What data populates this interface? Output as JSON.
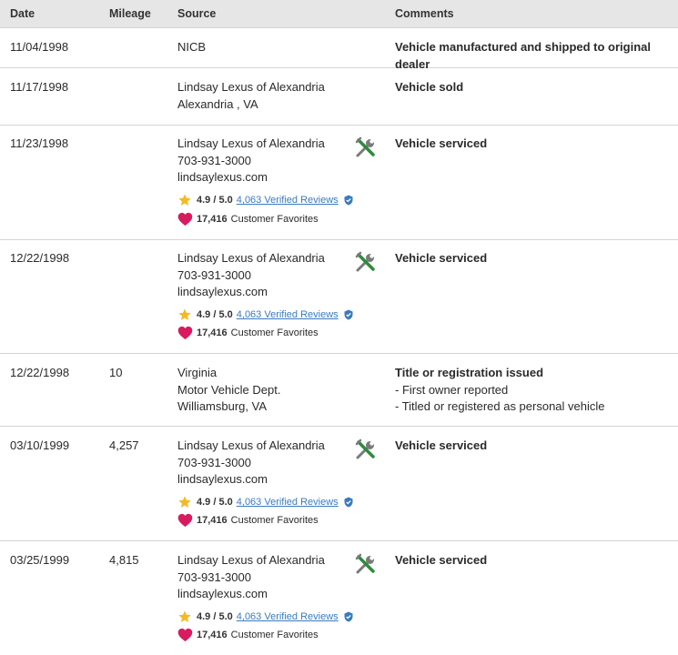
{
  "header": {
    "date": "Date",
    "mileage": "Mileage",
    "source": "Source",
    "comments": "Comments"
  },
  "dealer": {
    "name": "Lindsay Lexus of Alexandria",
    "phone": "703-931-3000",
    "site": "lindsaylexus.com",
    "score": "4.9 / 5.0",
    "reviews": "4,063 Verified Reviews",
    "favorites_count": "17,416",
    "favorites_label": "Customer Favorites"
  },
  "rows": [
    {
      "date": "11/04/1998",
      "mileage": "",
      "source": [
        "NICB"
      ],
      "comment_title": "Vehicle manufactured and shipped to original dealer",
      "comment_lines": []
    },
    {
      "date": "11/17/1998",
      "mileage": "",
      "source": [
        "Lindsay Lexus of Alexandria",
        "Alexandria , VA"
      ],
      "comment_title": "Vehicle sold",
      "comment_lines": []
    },
    {
      "date": "11/23/1998",
      "mileage": "",
      "comment_title": "Vehicle serviced"
    },
    {
      "date": "12/22/1998",
      "mileage": "",
      "comment_title": "Vehicle serviced"
    },
    {
      "date": "12/22/1998",
      "mileage": "10",
      "source": [
        "Virginia",
        "Motor Vehicle Dept.",
        "Williamsburg, VA"
      ],
      "comment_title": "Title or registration issued",
      "comment_lines": [
        "- First owner reported",
        "- Titled or registered as personal vehicle"
      ]
    },
    {
      "date": "03/10/1999",
      "mileage": "4,257",
      "comment_title": "Vehicle serviced"
    },
    {
      "date": "03/25/1999",
      "mileage": "4,815",
      "comment_title": "Vehicle serviced"
    }
  ],
  "colors": {
    "header_bg": "#e6e6e6",
    "link": "#3a7bbf",
    "star": "#f5b923",
    "heart": "#d81b60",
    "shield": "#3a7bbf",
    "wrench_green": "#2e8b3a",
    "wrench_gray": "#7a7a7a"
  }
}
